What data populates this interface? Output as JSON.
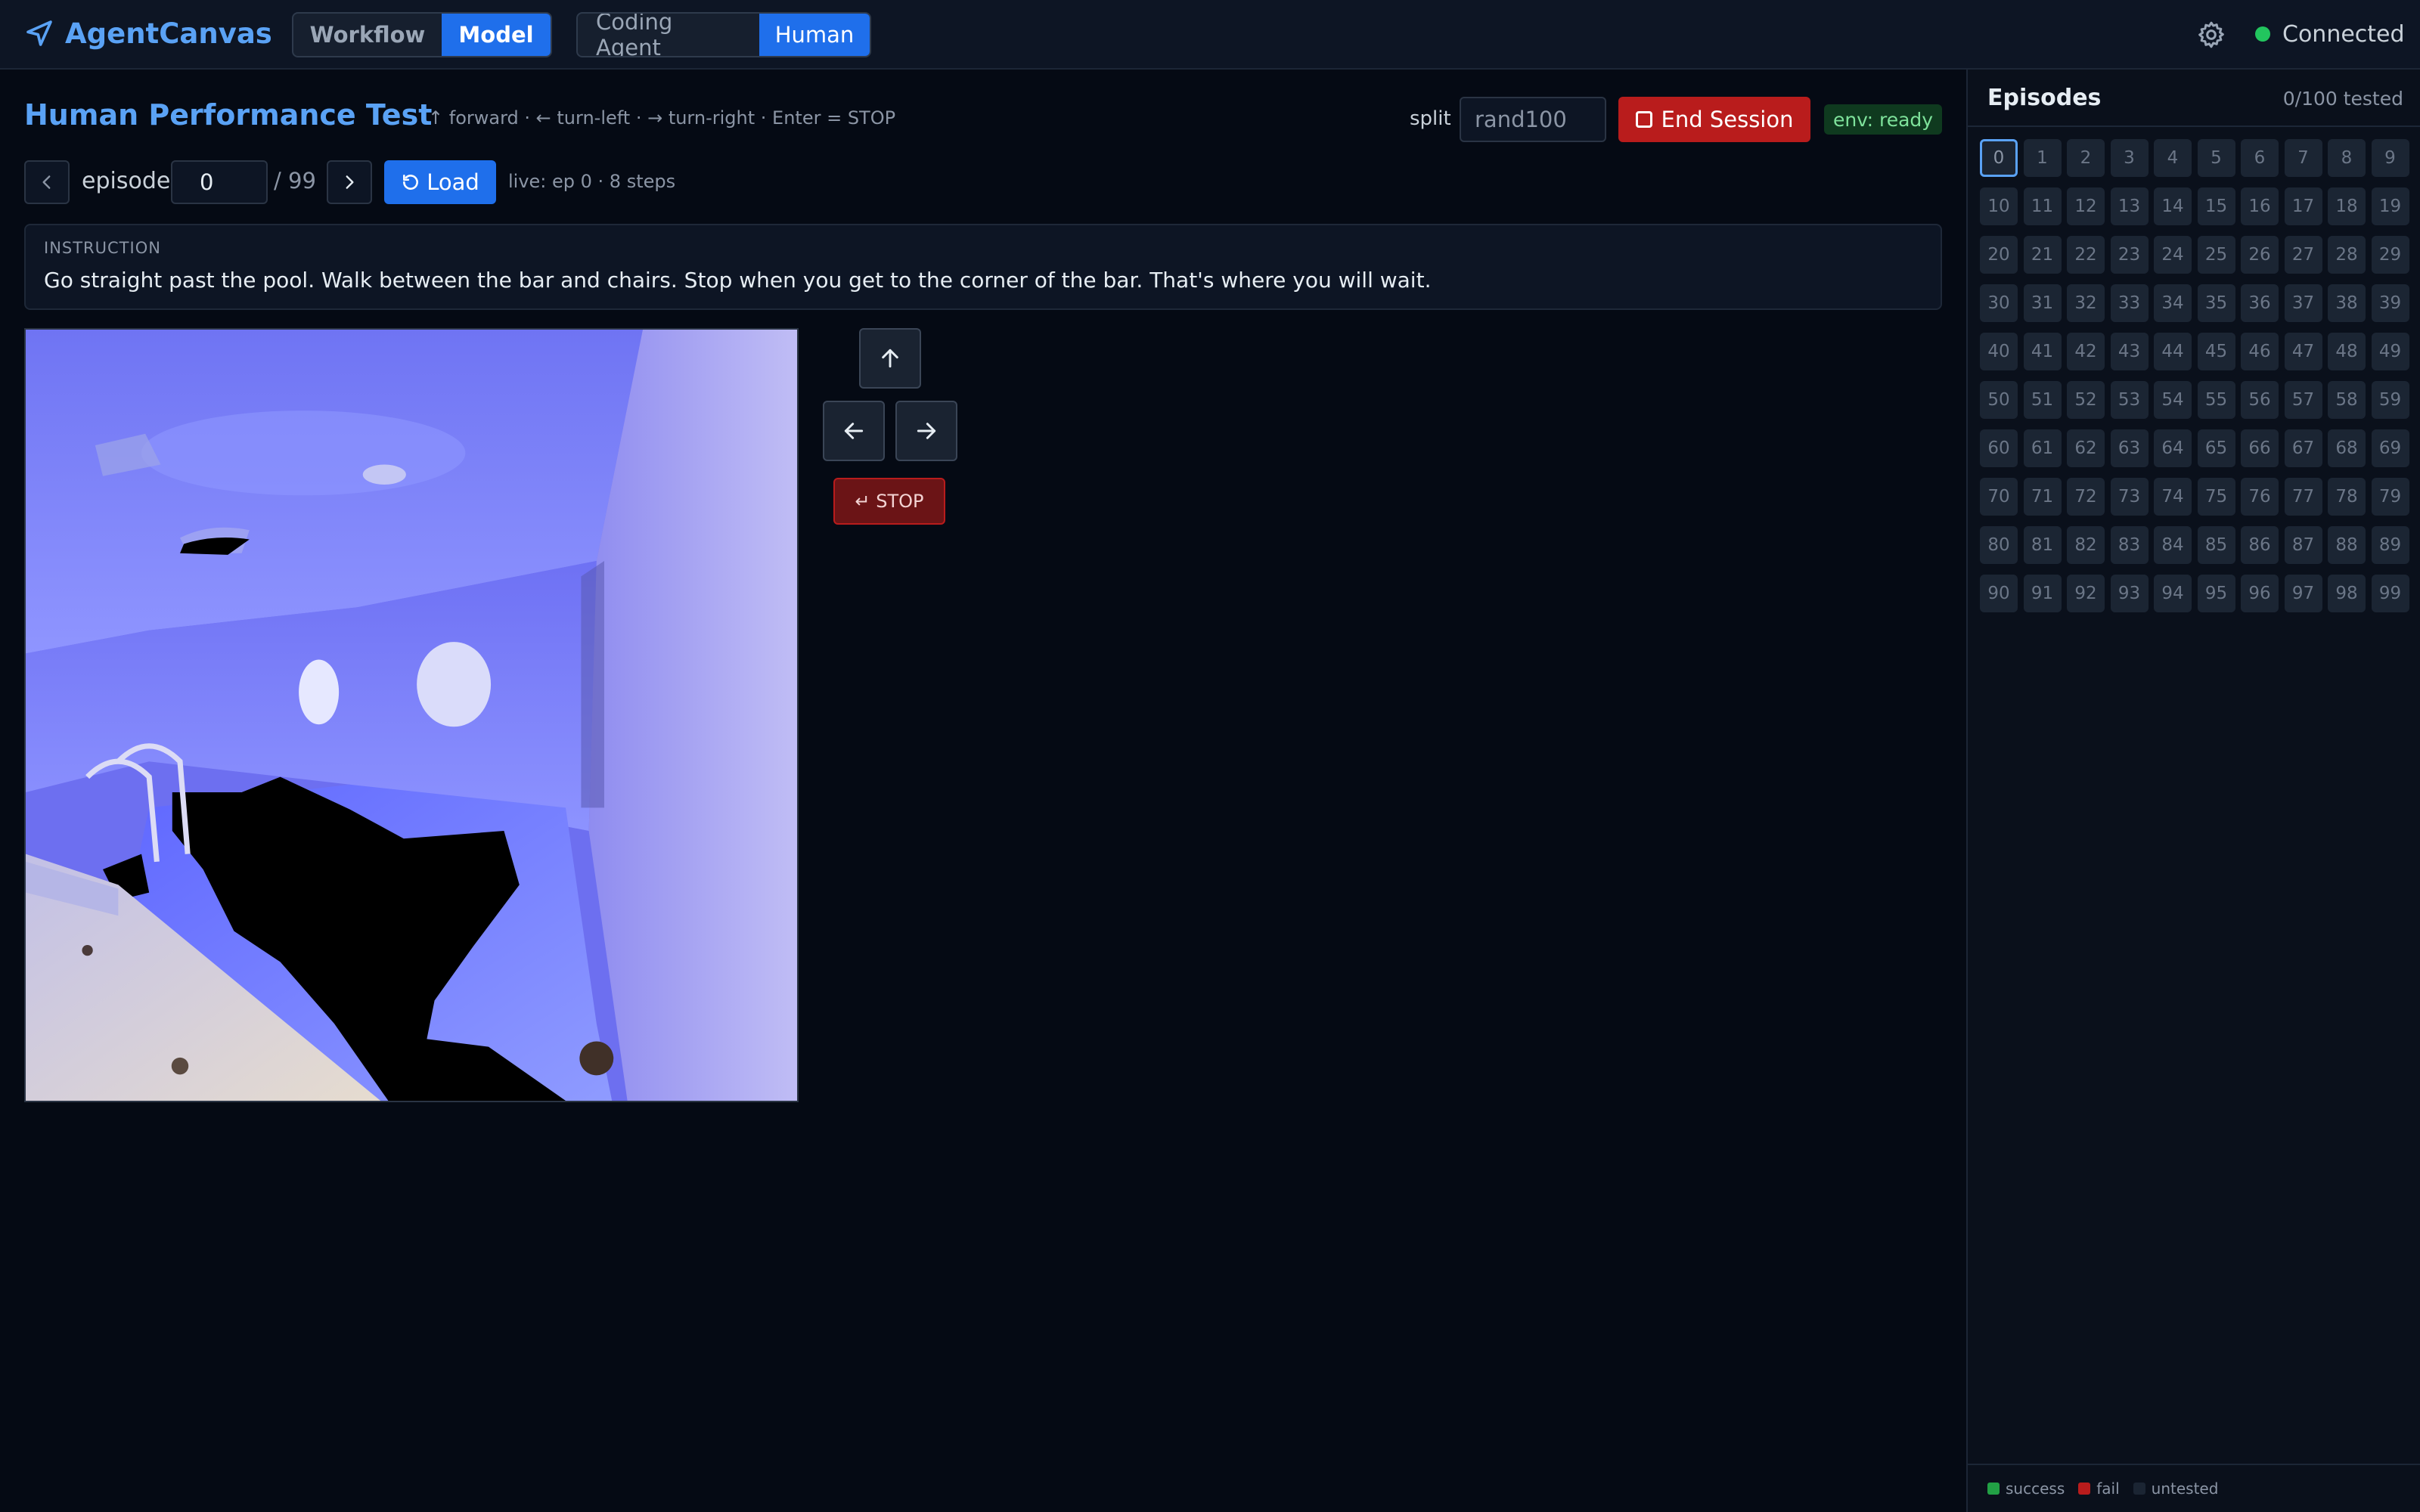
{
  "app": {
    "name": "AgentCanvas",
    "mode_tabs": [
      {
        "label": "Workflow",
        "active": false
      },
      {
        "label": "Model",
        "active": true
      }
    ],
    "agent_tabs": [
      {
        "label": "Coding Agent",
        "active": false
      },
      {
        "label": "Human",
        "active": true
      }
    ],
    "connection_status": "Connected",
    "colors": {
      "accent": "#1f6feb",
      "brand": "#5aa2f5",
      "connected": "#22c55e",
      "danger": "#b91c1c"
    }
  },
  "header": {
    "title": "Human Performance Test",
    "hint": "↑ forward · ← turn-left · → turn-right · Enter = STOP",
    "split_label": "split",
    "split_placeholder": "rand100",
    "end_session_label": "End Session",
    "env_status": "env: ready"
  },
  "episode_nav": {
    "label": "episode",
    "value": "0",
    "total": "/ 99",
    "load_label": "Load",
    "live_status": "live: ep 0 · 8 steps"
  },
  "instruction": {
    "label": "INSTRUCTION",
    "text": "Go straight past the pool. Walk between the bar and chairs. Stop when you get to the corner of the bar. That's where you will wait."
  },
  "controls": {
    "forward_icon": "arrow-up-icon",
    "left_icon": "arrow-left-icon",
    "right_icon": "arrow-right-icon",
    "stop_label": "↵ STOP"
  },
  "sidebar": {
    "title": "Episodes",
    "tested_count": "0/100 tested",
    "current_episode": 0,
    "episode_count": 100,
    "legend": [
      {
        "label": "success",
        "color": "#22a045"
      },
      {
        "label": "fail",
        "color": "#b91c1c"
      },
      {
        "label": "untested",
        "color": "#1b2533"
      }
    ]
  }
}
